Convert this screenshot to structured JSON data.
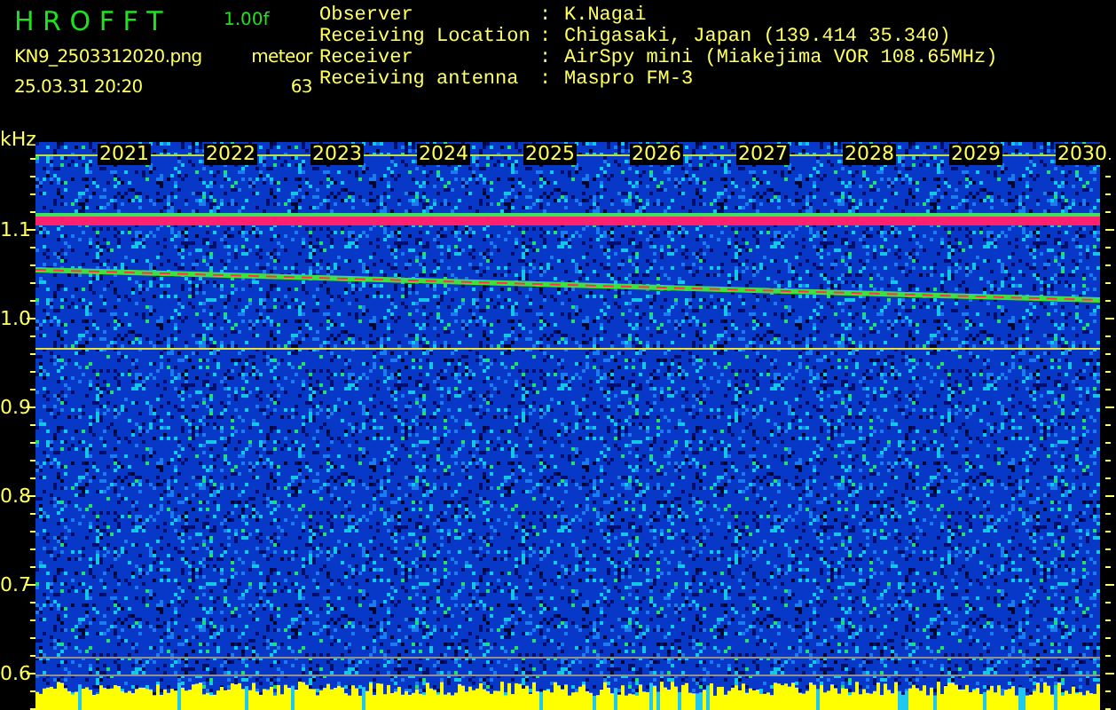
{
  "header": {
    "title": "H R O F F T",
    "version": "1.00f",
    "filename": "KN9_2503312020.png",
    "mode": "meteor",
    "datetime": "25.03.31 20:20",
    "count": "63"
  },
  "separator": ":",
  "info": [
    {
      "label": "Observer",
      "value": "K.Nagai"
    },
    {
      "label": "Receiving Location",
      "value": "Chigasaki, Japan (139.414 35.340)"
    },
    {
      "label": "Receiver",
      "value": "AirSpy mini (Miakejima VOR 108.65MHz)"
    },
    {
      "label": "Receiving antenna",
      "value": "Maspro FM-3"
    }
  ],
  "plot": {
    "y_unit": "kHz",
    "y_labels": [
      "1.1",
      "1.0",
      "0.9",
      "0.8",
      "0.7",
      "0.6"
    ],
    "x_labels": [
      "2021",
      "2022",
      "2023",
      "2024",
      "2025",
      "2026",
      "2027",
      "2028",
      "2029",
      "2030"
    ]
  }
}
